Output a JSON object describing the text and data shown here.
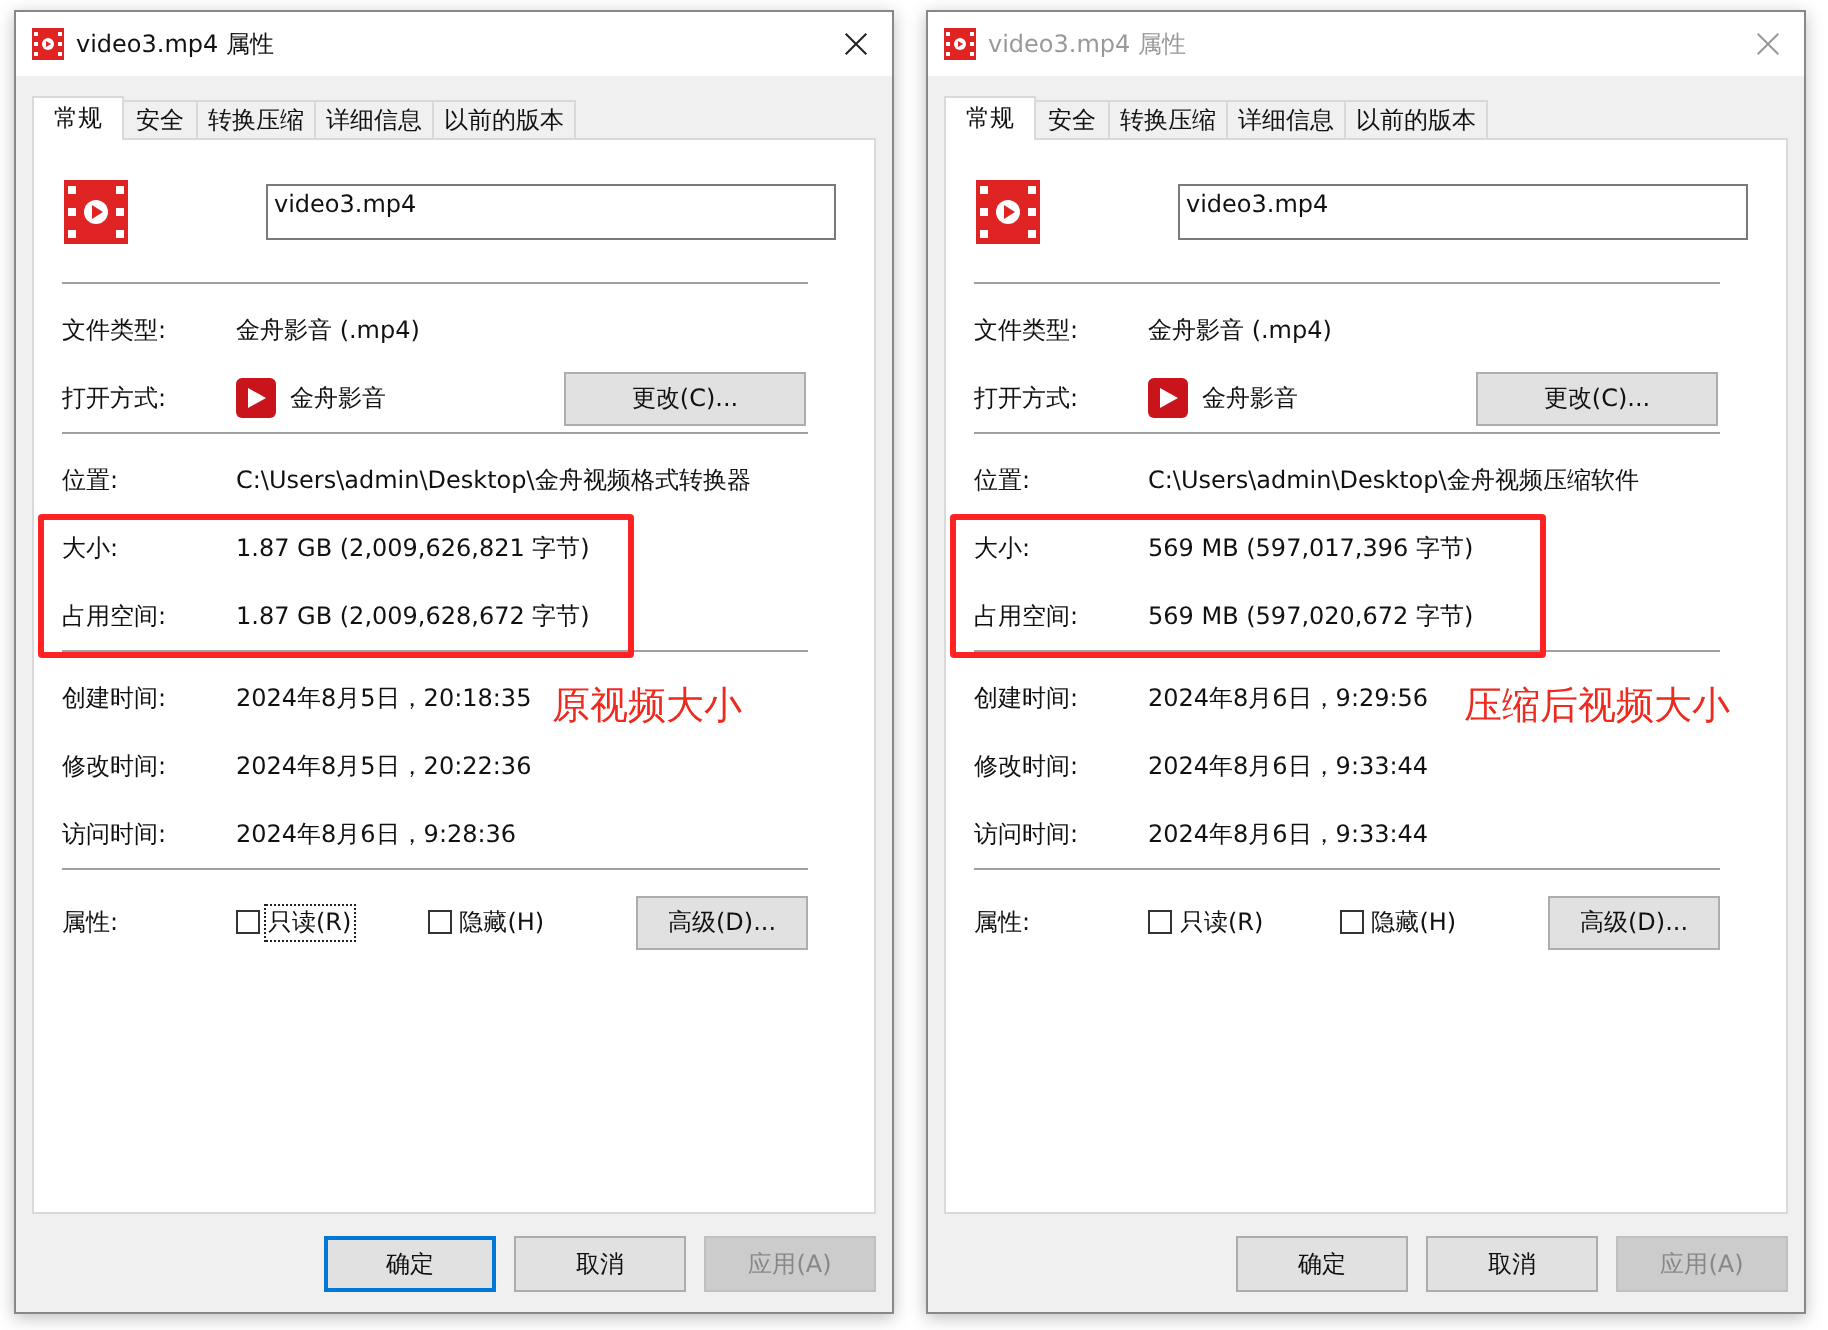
{
  "windows": [
    {
      "title": "video3.mp4 属性",
      "active": true,
      "tabs": [
        {
          "label": "常规",
          "selected": true
        },
        {
          "label": "安全",
          "selected": false
        },
        {
          "label": "转换压缩",
          "selected": false
        },
        {
          "label": "详细信息",
          "selected": false
        },
        {
          "label": "以前的版本",
          "selected": false
        }
      ],
      "file_name": "video3.mp4",
      "type_row": {
        "label": "文件类型:",
        "value": "金舟影音 (.mp4)"
      },
      "open_with": {
        "label": "打开方式:",
        "app": "金舟影音",
        "button": "更改(C)..."
      },
      "location": {
        "label": "位置:",
        "value": "C:\\Users\\admin\\Desktop\\金舟视频格式转换器"
      },
      "size_rows": [
        {
          "label": "大小:",
          "value": "1.87 GB (2,009,626,821 字节)"
        },
        {
          "label": "占用空间:",
          "value": "1.87 GB (2,009,628,672 字节)"
        }
      ],
      "size_highlighted": true,
      "time_rows": [
        {
          "label": "创建时间:",
          "value": "2024年8月5日，20:18:35"
        },
        {
          "label": "修改时间:",
          "value": "2024年8月5日，20:22:36"
        },
        {
          "label": "访问时间:",
          "value": "2024年8月6日，9:28:36"
        }
      ],
      "annotation": "原视频大小",
      "attributes": {
        "label": "属性:",
        "checkboxes": [
          {
            "label": "只读(R)",
            "checked": false,
            "focused": true
          },
          {
            "label": "隐藏(H)",
            "checked": false,
            "focused": false
          }
        ],
        "button": "高级(D)..."
      },
      "buttons": [
        {
          "label": "确定",
          "default": true,
          "disabled": false
        },
        {
          "label": "取消",
          "default": false,
          "disabled": false
        },
        {
          "label": "应用(A)",
          "default": false,
          "disabled": true
        }
      ]
    },
    {
      "title": "video3.mp4 属性",
      "active": false,
      "tabs": [
        {
          "label": "常规",
          "selected": true
        },
        {
          "label": "安全",
          "selected": false
        },
        {
          "label": "转换压缩",
          "selected": false
        },
        {
          "label": "详细信息",
          "selected": false
        },
        {
          "label": "以前的版本",
          "selected": false
        }
      ],
      "file_name": "video3.mp4",
      "type_row": {
        "label": "文件类型:",
        "value": "金舟影音 (.mp4)"
      },
      "open_with": {
        "label": "打开方式:",
        "app": "金舟影音",
        "button": "更改(C)..."
      },
      "location": {
        "label": "位置:",
        "value": "C:\\Users\\admin\\Desktop\\金舟视频压缩软件"
      },
      "size_rows": [
        {
          "label": "大小:",
          "value": "569 MB (597,017,396 字节)"
        },
        {
          "label": "占用空间:",
          "value": "569 MB (597,020,672 字节)"
        }
      ],
      "size_highlighted": true,
      "time_rows": [
        {
          "label": "创建时间:",
          "value": "2024年8月6日，9:29:56"
        },
        {
          "label": "修改时间:",
          "value": "2024年8月6日，9:33:44"
        },
        {
          "label": "访问时间:",
          "value": "2024年8月6日，9:33:44"
        }
      ],
      "annotation": "压缩后视频大小",
      "attributes": {
        "label": "属性:",
        "checkboxes": [
          {
            "label": "只读(R)",
            "checked": false,
            "focused": false
          },
          {
            "label": "隐藏(H)",
            "checked": false,
            "focused": false
          }
        ],
        "button": "高级(D)..."
      },
      "buttons": [
        {
          "label": "确定",
          "default": false,
          "disabled": false
        },
        {
          "label": "取消",
          "default": false,
          "disabled": false
        },
        {
          "label": "应用(A)",
          "default": false,
          "disabled": true
        }
      ]
    }
  ]
}
